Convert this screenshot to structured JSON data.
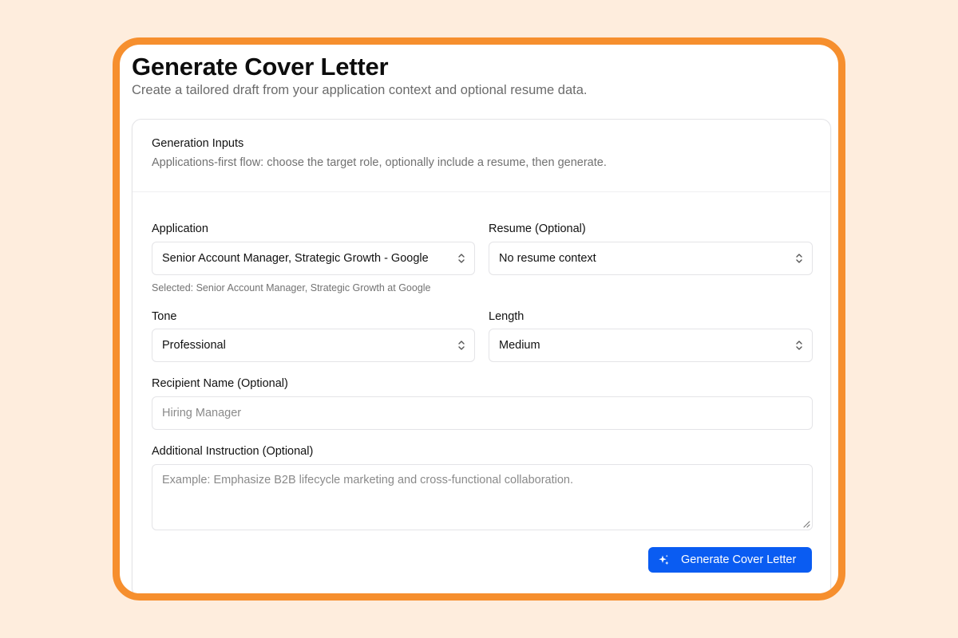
{
  "page": {
    "title": "Generate Cover Letter",
    "subtitle": "Create a tailored draft from your application context and optional resume data."
  },
  "card": {
    "title": "Generation Inputs",
    "description": "Applications-first flow: choose the target role, optionally include a resume, then generate."
  },
  "form": {
    "application": {
      "label": "Application",
      "value": "Senior Account Manager, Strategic Growth - Google",
      "helper": "Selected: Senior Account Manager, Strategic Growth at Google"
    },
    "resume": {
      "label": "Resume (Optional)",
      "value": "No resume context"
    },
    "tone": {
      "label": "Tone",
      "value": "Professional"
    },
    "length": {
      "label": "Length",
      "value": "Medium"
    },
    "recipient": {
      "label": "Recipient Name (Optional)",
      "value": "",
      "placeholder": "Hiring Manager"
    },
    "instruction": {
      "label": "Additional Instruction (Optional)",
      "value": "",
      "placeholder": "Example: Emphasize B2B lifecycle marketing and cross-functional collaboration."
    },
    "submit": {
      "label": "Generate Cover Letter",
      "icon": "sparkles-icon"
    }
  },
  "colors": {
    "background": "#feeddd",
    "frame_border": "#f68f2e",
    "primary_button": "#0a5cf2"
  },
  "icons": {
    "select_indicator": "chevron-up-down-icon",
    "textarea_resize": "resize-handle-icon"
  }
}
